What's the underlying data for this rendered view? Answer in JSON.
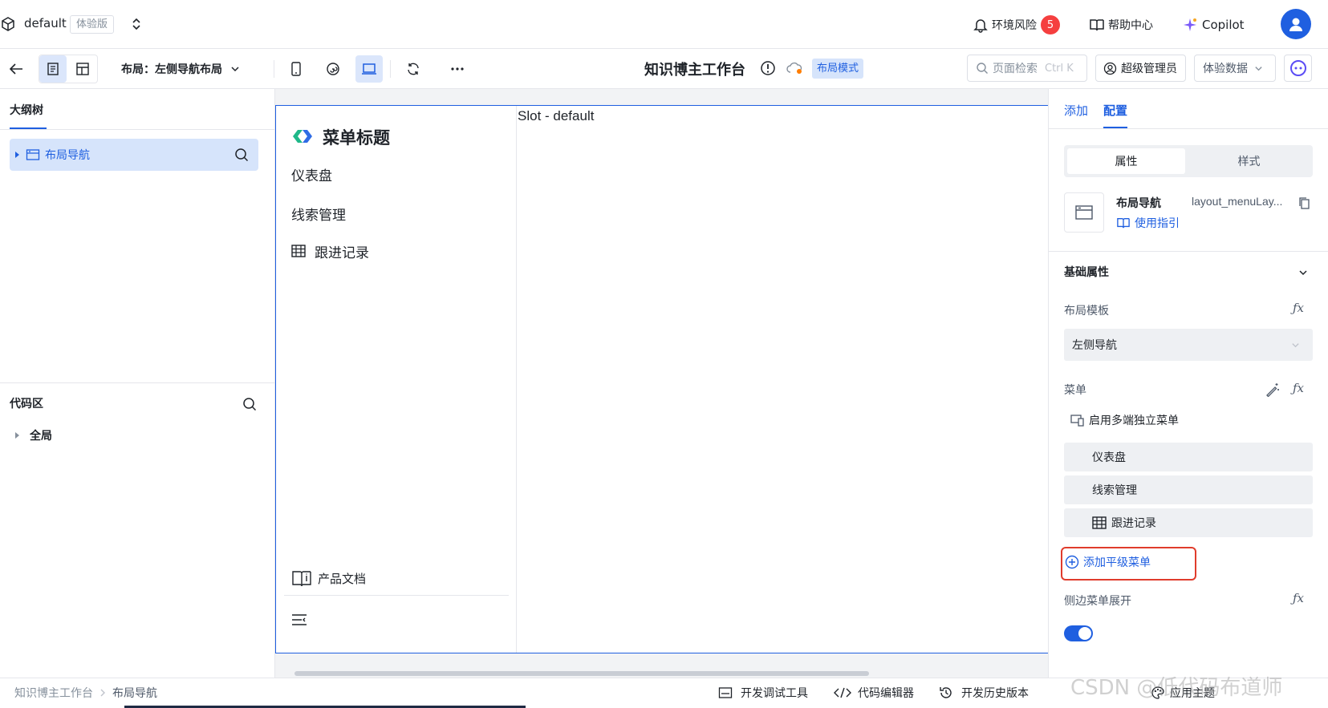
{
  "topbar": {
    "app_name": "default",
    "edition_badge": "体验版",
    "env_risk_label": "环境风险",
    "env_risk_count": "5",
    "help_label": "帮助中心",
    "copilot_label": "Copilot"
  },
  "toolbar": {
    "layout_label": "布局：左侧导航布局",
    "page_title": "知识博主工作台",
    "mode_badge": "布局模式",
    "search_placeholder": "页面检索",
    "search_shortcut": "Ctrl K",
    "admin_label": "超级管理员",
    "data_select": "体验数据"
  },
  "left_panel": {
    "outline_tab": "大纲树",
    "tree_item": "布局导航",
    "code_title": "代码区",
    "code_item": "全局"
  },
  "canvas": {
    "menu_title": "菜单标题",
    "menu_items": [
      "仪表盘",
      "线索管理",
      "跟进记录"
    ],
    "doc_link": "产品文档",
    "slot_label": "Slot - default"
  },
  "right_panel": {
    "tabs": [
      "添加",
      "配置"
    ],
    "segment": [
      "属性",
      "样式"
    ],
    "component_name": "布局导航",
    "component_id": "layout_menuLay...",
    "guide_link": "使用指引",
    "section_title": "基础属性",
    "layout_template_label": "布局模板",
    "layout_template_value": "左侧导航",
    "menu_label": "菜单",
    "multi_menu_label": "启用多端独立菜单",
    "menu_items": [
      "仪表盘",
      "线索管理",
      "跟进记录"
    ],
    "add_menu_label": "添加平级菜单",
    "side_expand_label": "侧边菜单展开",
    "side_expand_on": true
  },
  "statusbar": {
    "breadcrumb": [
      "知识博主工作台",
      "布局导航"
    ],
    "dev_tools": "开发调试工具",
    "code_editor": "代码编辑器",
    "history": "开发历史版本",
    "apply_theme": "应用主题",
    "watermark": "CSDN @低代码布道师"
  },
  "colors": {
    "accent": "#1f5fe0",
    "badge_red": "#f53f3f",
    "highlight_box": "#e03c2c",
    "selected_bg": "#d6e4fb"
  }
}
